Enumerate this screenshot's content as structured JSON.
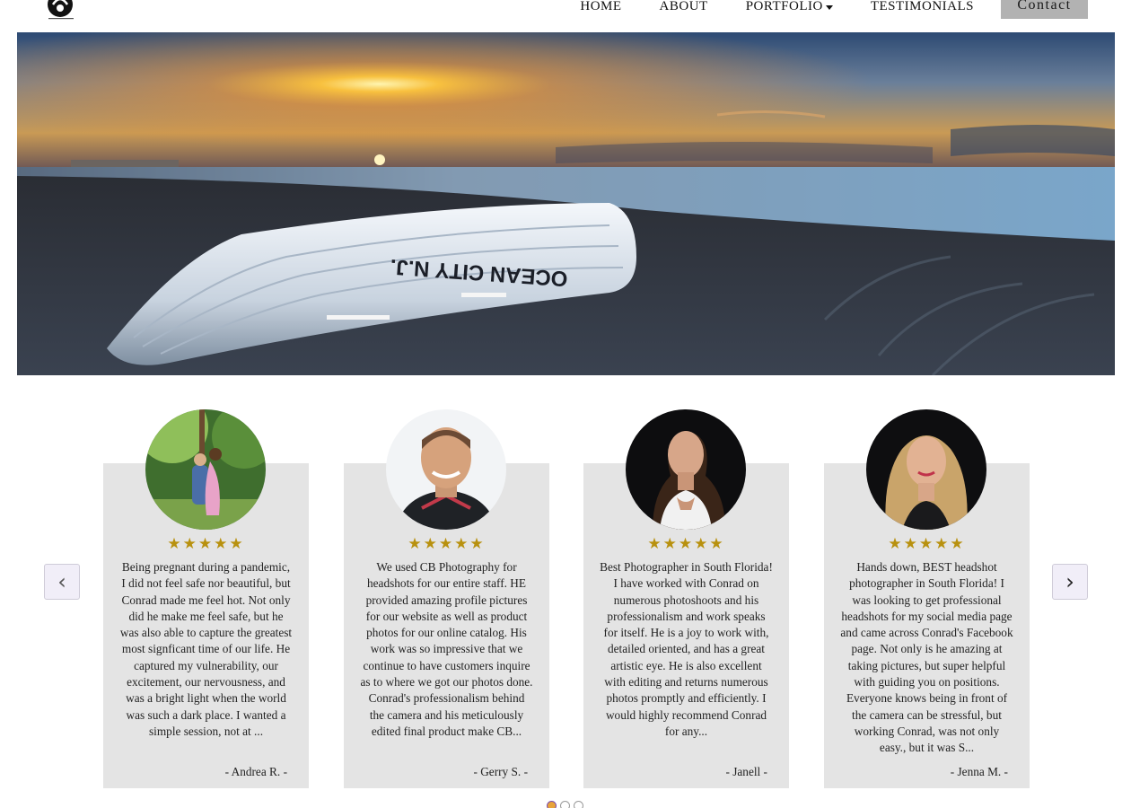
{
  "nav": {
    "items": [
      "HOME",
      "ABOUT",
      "PORTFOLIO",
      "TESTIMONIALS"
    ],
    "contact_label": "Contact"
  },
  "hero": {
    "boat_text": "OCEAN CITY N.J."
  },
  "testimonials": {
    "prev_label": "‹",
    "next_label": "›",
    "rating_label": "★★★★★",
    "items": [
      {
        "text": "Being pregnant during a pandemic, I did not feel safe nor beautiful, but Conrad made me feel hot. Not only did he make me feel safe, but he was also able to capture the greatest most signficant time of our life. He captured my vulnerability, our excitement, our nervousness, and was a bright light when the world was such a dark place. I wanted a simple session, not at ...",
        "author": "- Andrea R. -",
        "rating": 5
      },
      {
        "text": "We used CB Photography for headshots for our entire staff. HE provided amazing profile pictures for our website as well as product photos for our online catalog. His work was so impressive that we continue to have customers inquire as to where we got our photos done. Conrad's professionalism behind the camera and his meticulously edited final product make CB...",
        "author": "- Gerry S. -",
        "rating": 5
      },
      {
        "text": "Best Photographer in South Florida! I have worked with Conrad on numerous photoshoots and his professionalism and work speaks for itself. He is a joy to work with, detailed oriented, and has a great artistic eye. He is also excellent with editing and returns numerous photos promptly and efficiently. I would highly recommend Conrad for any...",
        "author": "- Janell -",
        "rating": 5
      },
      {
        "text": "Hands down, BEST headshot photographer in South Florida! I was looking to get professional headshots for my social media page and came across Conrad's Facebook page. Not only is he amazing at taking pictures, but super helpful with guiding you on positions. Everyone knows being in front of the camera can be stressful, but working Conrad, was not only easy., but it was S...",
        "author": "- Jenna M. -",
        "rating": 5
      }
    ],
    "dots": 3,
    "active_dot": 0
  },
  "colors": {
    "star": "#b8910f",
    "card_bg": "#e4e4e4",
    "contact_bg": "#b2b2b2"
  }
}
